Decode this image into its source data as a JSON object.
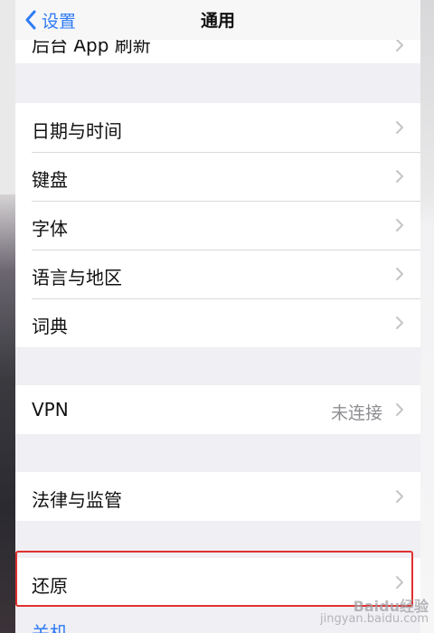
{
  "navbar": {
    "back_label": "设置",
    "title": "通用"
  },
  "cut_row": {
    "label": "后台 App 刷新"
  },
  "group1": [
    {
      "label": "日期与时间"
    },
    {
      "label": "键盘"
    },
    {
      "label": "字体"
    },
    {
      "label": "语言与地区"
    },
    {
      "label": "词典"
    }
  ],
  "group2": [
    {
      "label": "VPN",
      "value": "未连接"
    }
  ],
  "group3": [
    {
      "label": "法律与监管"
    }
  ],
  "group4": [
    {
      "label": "还原"
    }
  ],
  "partial_label": "关机",
  "watermark": {
    "brand": "Baidu经验",
    "site": "jingyan.baidu.com"
  },
  "colors": {
    "accent": "#2f7bf6",
    "highlight": "#e0302f",
    "background": "#efeff4"
  }
}
